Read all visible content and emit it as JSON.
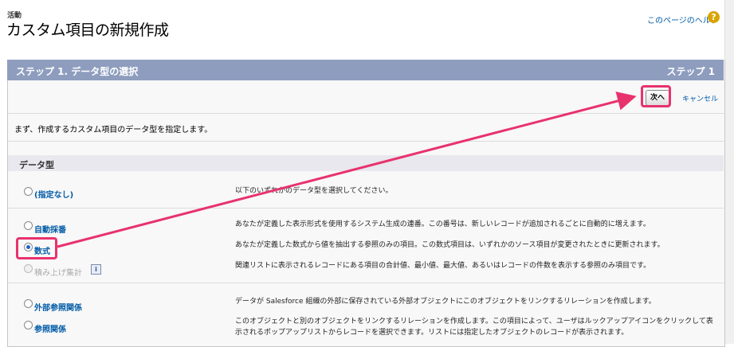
{
  "header": {
    "subtitle": "活動",
    "title": "カスタム項目の新規作成",
    "help_link": "このページのヘルプ",
    "help_icon": "?"
  },
  "step_bar": {
    "left": "ステップ 1. データ型の選択",
    "right": "ステップ 1"
  },
  "buttons": {
    "next": "次へ",
    "cancel": "キャンセル"
  },
  "intro": "まず、作成するカスタム項目のデータ型を指定します。",
  "section_title": "データ型",
  "options": [
    {
      "label": "(指定なし)",
      "desc": "以下のいずれかのデータ型を選択してください。",
      "selected": false,
      "disabled": false
    },
    {
      "label": "自動採番",
      "desc": "あなたが定義した表示形式を使用するシステム生成の連番。この番号は、新しいレコードが追加されるごとに自動的に増えます。",
      "selected": false,
      "disabled": false
    },
    {
      "label": "数式",
      "desc": "あなたが定義した数式から値を抽出する参照のみの項目。この数式項目は、いずれかのソース項目が変更されたときに更新されます。",
      "selected": true,
      "disabled": false
    },
    {
      "label": "積み上げ集計",
      "desc": "関連リストに表示されるレコードにある項目の合計値、最小値、最大値、あるいはレコードの件数を表示する参照のみ項目です。",
      "selected": false,
      "disabled": true,
      "info_icon": "i"
    },
    {
      "label": "外部参照関係",
      "desc": "データが Salesforce 組織の外部に保存されている外部オブジェクトにこのオブジェクトをリンクするリレーションを作成します。",
      "selected": false,
      "disabled": false
    },
    {
      "label": "参照関係",
      "desc": "このオブジェクトと別のオブジェクトをリンクするリレーションを作成します。この項目によって、ユーザはルックアップアイコンをクリックして表示されるポップアップリストからレコードを選択できます。リストには指定したオブジェクトのレコードが表示されます。",
      "selected": false,
      "disabled": false
    }
  ],
  "colors": {
    "step_bar": "#8e9dbe",
    "link": "#015ba7",
    "highlight": "#e8326e"
  }
}
